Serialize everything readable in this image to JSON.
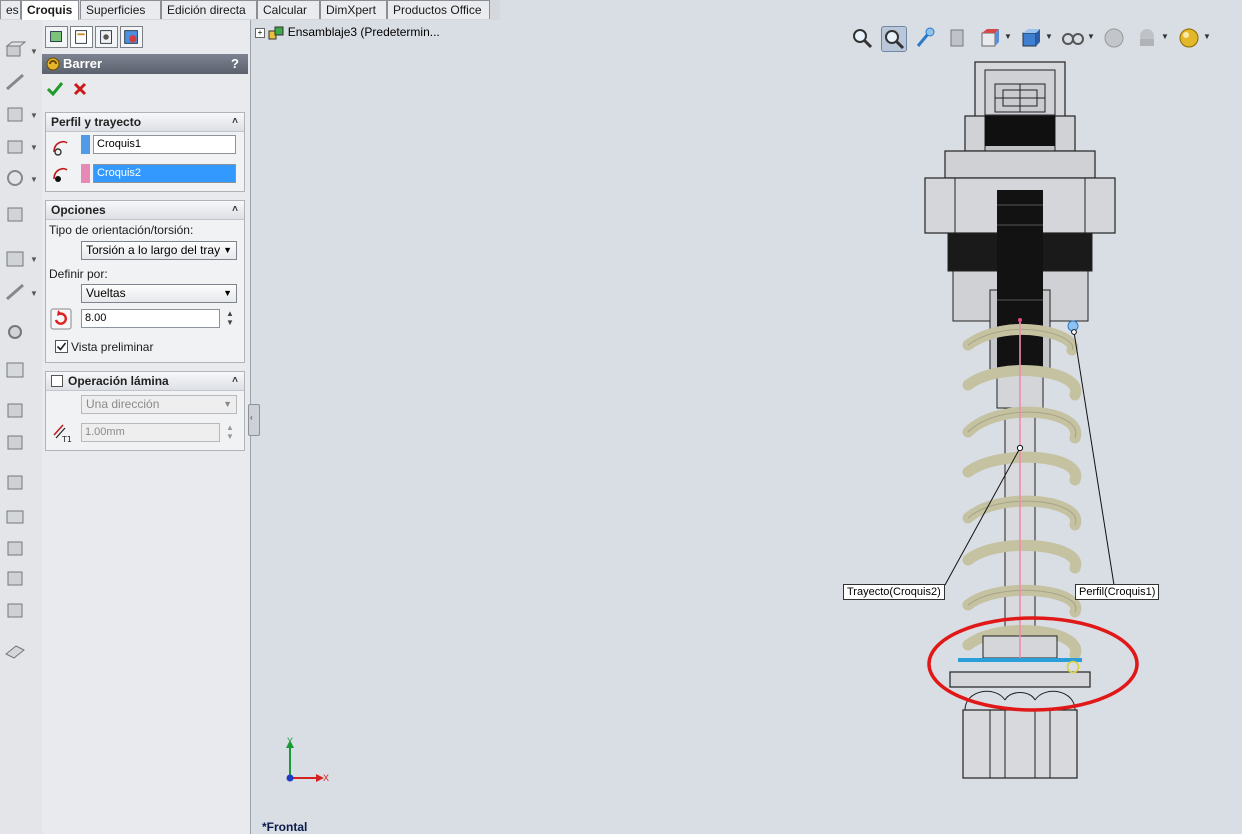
{
  "tabs": [
    {
      "label": "es",
      "active": false
    },
    {
      "label": "Croquis",
      "active": true
    },
    {
      "label": "Superficies",
      "active": false
    },
    {
      "label": "Edición directa",
      "active": false
    },
    {
      "label": "Calcular",
      "active": false
    },
    {
      "label": "DimXpert",
      "active": false
    },
    {
      "label": "Productos Office",
      "active": false
    }
  ],
  "property_manager": {
    "title": "Barrer",
    "help": "?",
    "ok_icon": "check-icon",
    "cancel_icon": "x-icon",
    "profile_group": {
      "title": "Perfil y trayecto",
      "profile_value": "Croquis1",
      "path_value": "Croquis2",
      "profile_color": "#4f9be8",
      "path_color": "#e889b5"
    },
    "options_group": {
      "title": "Opciones",
      "orientation_label": "Tipo de orientación/torsión:",
      "orientation_value": "Torsión a lo largo del tray",
      "define_label": "Definir por:",
      "define_value": "Vueltas",
      "turns_value": "8.00",
      "preview_label": "Vista preliminar",
      "preview_checked": true
    },
    "thin_group": {
      "title": "Operación lámina",
      "direction_value": "Una dirección",
      "thickness_value": "1.00mm"
    }
  },
  "viewport": {
    "tree_label": "Ensamblaje3  (Predetermin...",
    "path_callout": "Trayecto(Croquis2)",
    "profile_callout": "Perfil(Croquis1)",
    "view_name": "*Frontal",
    "axis_x": "X",
    "axis_y": "Y"
  }
}
